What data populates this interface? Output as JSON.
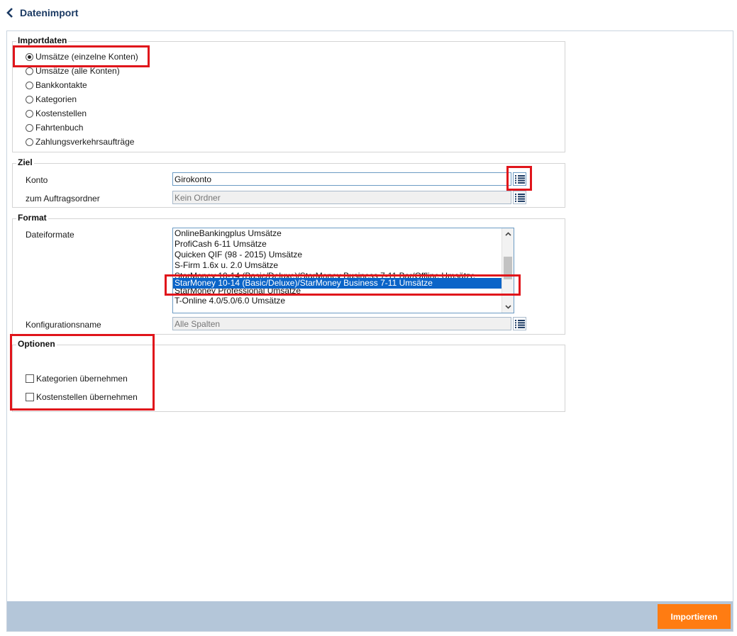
{
  "header": {
    "title": "Datenimport"
  },
  "importdaten": {
    "legend": "Importdaten",
    "options": [
      {
        "label": "Umsätze (einzelne Konten)",
        "checked": true
      },
      {
        "label": "Umsätze (alle Konten)",
        "checked": false
      },
      {
        "label": "Bankkontakte",
        "checked": false
      },
      {
        "label": "Kategorien",
        "checked": false
      },
      {
        "label": "Kostenstellen",
        "checked": false
      },
      {
        "label": "Fahrtenbuch",
        "checked": false
      },
      {
        "label": "Zahlungsverkehrsaufträge",
        "checked": false
      }
    ]
  },
  "ziel": {
    "legend": "Ziel",
    "konto_label": "Konto",
    "konto_value": "Girokonto",
    "ordner_label": "zum Auftragsordner",
    "ordner_placeholder": "Kein Ordner"
  },
  "format": {
    "legend": "Format",
    "dateiformate_label": "Dateiformate",
    "items": [
      "OnlineBankingplus Umsätze",
      "ProfiCash 6-11 Umsätze",
      "Quicken QIF (98 - 2015) Umsätze",
      "S-Firm 1.6x u. 2.0 Umsätze",
      "StarMoney 10-14 (Basic/Deluxe)/StarMoney Business 7-11 Bar/Offline Umsätze",
      "StarMoney 10-14 (Basic/Deluxe)/StarMoney Business 7-11 Umsätze",
      "StarMoney Professional Umsätze",
      "T-Online 4.0/5.0/6.0 Umsätze"
    ],
    "selected_index": 5,
    "konfig_label": "Konfigurationsname",
    "konfig_placeholder": "Alle Spalten"
  },
  "optionen": {
    "legend": "Optionen",
    "checks": [
      {
        "label": "Kategorien übernehmen",
        "checked": false
      },
      {
        "label": "Kostenstellen übernehmen",
        "checked": false
      }
    ]
  },
  "footer": {
    "import_label": "Importieren"
  },
  "colors": {
    "accent": "#ff7c12",
    "highlight": "#e0151b",
    "selection": "#0a64c8",
    "footer": "#b4c6d9",
    "title": "#1b3a63"
  },
  "icons": {
    "back": "chevron-left-icon",
    "list": "list-icon"
  }
}
